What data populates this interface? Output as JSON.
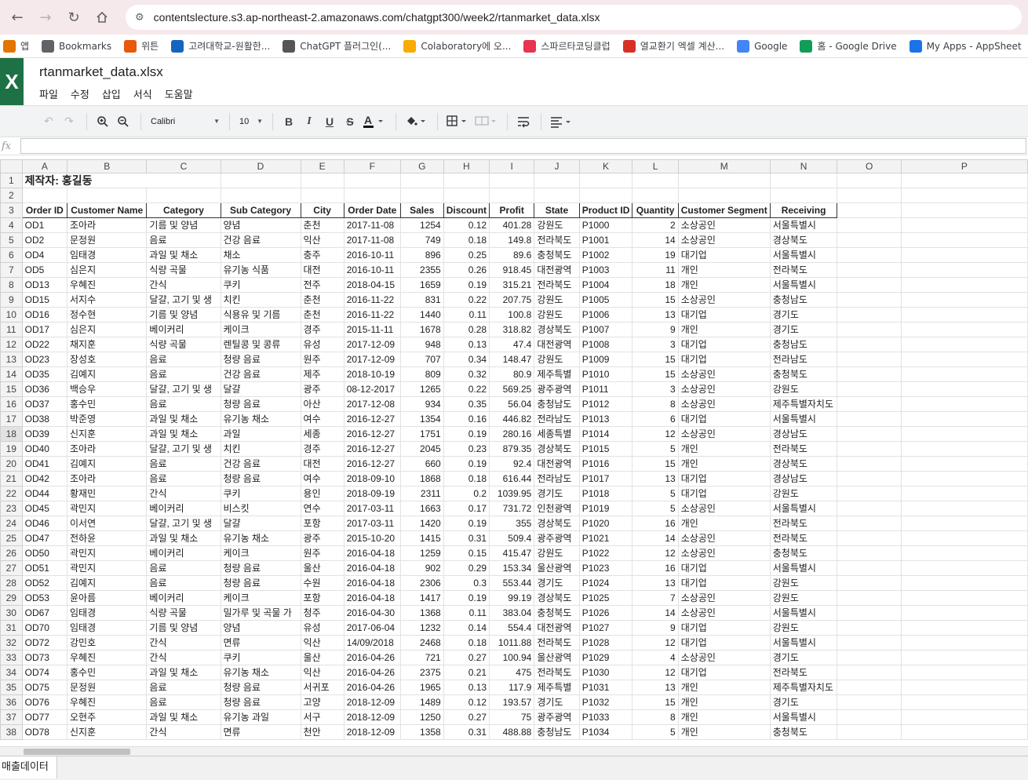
{
  "browser": {
    "url": "contentslecture.s3.ap-northeast-2.amazonaws.com/chatgpt300/week2/rtanmarket_data.xlsx"
  },
  "bookmarks": [
    {
      "label": "앱",
      "icon": "apps-grid-icon",
      "color": "#e37400"
    },
    {
      "label": "Bookmarks",
      "icon": "star-icon",
      "color": "#5f6368"
    },
    {
      "label": "위튼",
      "icon": "wetoon-icon",
      "color": "#e8590c"
    },
    {
      "label": "고려대학교-원활한...",
      "icon": "korea-univ-icon",
      "color": "#1565c0"
    },
    {
      "label": "ChatGPT 플러그인(...",
      "icon": "chatgpt-plugin-icon",
      "color": "#555555"
    },
    {
      "label": "Colaboratory에 오...",
      "icon": "colab-icon",
      "color": "#f9ab00"
    },
    {
      "label": "스파르타코딩클럽",
      "icon": "sparta-icon",
      "color": "#e8344e"
    },
    {
      "label": "열교환기 엑셀 계산...",
      "icon": "heat-exchanger-icon",
      "color": "#d93025"
    },
    {
      "label": "Google",
      "icon": "google-icon",
      "color": "#4285f4"
    },
    {
      "label": "홈 - Google Drive",
      "icon": "google-drive-icon",
      "color": "#0f9d58"
    },
    {
      "label": "My Apps - AppSheet",
      "icon": "appsheet-icon",
      "color": "#1a73e8"
    }
  ],
  "app": {
    "logo": "X",
    "title": "rtanmarket_data.xlsx",
    "menus": [
      "파일",
      "수정",
      "삽입",
      "서식",
      "도움말"
    ],
    "font_name": "Calibri",
    "font_size": "10",
    "formula_label": "fx"
  },
  "sheet": {
    "columns": [
      "A",
      "B",
      "C",
      "D",
      "E",
      "F",
      "G",
      "H",
      "I",
      "J",
      "K",
      "L",
      "M",
      "N",
      "O",
      "P"
    ],
    "title_cell": "제작자: 홍길동",
    "headers": [
      "Order ID",
      "Customer Name",
      "Category",
      "Sub Category",
      "City",
      "Order Date",
      "Sales",
      "Discount",
      "Profit",
      "State",
      "Product ID",
      "Quantity",
      "Customer Segment",
      "Receiving"
    ],
    "rows": [
      [
        "OD1",
        "조아라",
        "기름 및 양념",
        "양념",
        "춘천",
        "2017-11-08",
        "1254",
        "0.12",
        "401.28",
        "강원도",
        "P1000",
        "2",
        "소상공인",
        "서울특별시"
      ],
      [
        "OD2",
        "문정원",
        "음료",
        "건강 음료",
        "익산",
        "2017-11-08",
        "749",
        "0.18",
        "149.8",
        "전라북도",
        "P1001",
        "14",
        "소상공인",
        "경상북도"
      ],
      [
        "OD4",
        "임태경",
        "과일 및 채소",
        "채소",
        "충주",
        "2016-10-11",
        "896",
        "0.25",
        "89.6",
        "충청북도",
        "P1002",
        "19",
        "대기업",
        "서울특별시"
      ],
      [
        "OD5",
        "심은지",
        "식량 곡물",
        "유기농 식품",
        "대전",
        "2016-10-11",
        "2355",
        "0.26",
        "918.45",
        "대전광역",
        "P1003",
        "11",
        "개인",
        "전라북도"
      ],
      [
        "OD13",
        "우혜진",
        "간식",
        "쿠키",
        "전주",
        "2018-04-15",
        "1659",
        "0.19",
        "315.21",
        "전라북도",
        "P1004",
        "18",
        "개인",
        "서울특별시"
      ],
      [
        "OD15",
        "서지수",
        "달걀, 고기 및 생",
        "치킨",
        "춘천",
        "2016-11-22",
        "831",
        "0.22",
        "207.75",
        "강원도",
        "P1005",
        "15",
        "소상공인",
        "충청남도"
      ],
      [
        "OD16",
        "정수현",
        "기름 및 양념",
        "식용유 및 기름",
        "춘천",
        "2016-11-22",
        "1440",
        "0.11",
        "100.8",
        "강원도",
        "P1006",
        "13",
        "대기업",
        "경기도"
      ],
      [
        "OD17",
        "심은지",
        "베이커리",
        "케이크",
        "경주",
        "2015-11-11",
        "1678",
        "0.28",
        "318.82",
        "경상북도",
        "P1007",
        "9",
        "개인",
        "경기도"
      ],
      [
        "OD22",
        "채지훈",
        "식량 곡물",
        "렌틸콩 및 콩류",
        "유성",
        "2017-12-09",
        "948",
        "0.13",
        "47.4",
        "대전광역",
        "P1008",
        "3",
        "대기업",
        "충청남도"
      ],
      [
        "OD23",
        "장성호",
        "음료",
        "청량 음료",
        "원주",
        "2017-12-09",
        "707",
        "0.34",
        "148.47",
        "강원도",
        "P1009",
        "15",
        "대기업",
        "전라남도"
      ],
      [
        "OD35",
        "김예지",
        "음료",
        "건강 음료",
        "제주",
        "2018-10-19",
        "809",
        "0.32",
        "80.9",
        "제주특별",
        "P1010",
        "15",
        "소상공인",
        "충청북도"
      ],
      [
        "OD36",
        "백승우",
        "달걀, 고기 및 생",
        "달걀",
        "광주",
        "08-12-2017",
        "1265",
        "0.22",
        "569.25",
        "광주광역",
        "P1011",
        "3",
        "소상공인",
        "강원도"
      ],
      [
        "OD37",
        "홍수민",
        "음료",
        "청량 음료",
        "아산",
        "2017-12-08",
        "934",
        "0.35",
        "56.04",
        "충청남도",
        "P1012",
        "8",
        "소상공인",
        "제주특별자치도"
      ],
      [
        "OD38",
        "박준영",
        "과일 및 채소",
        "유기농 채소",
        "여수",
        "2016-12-27",
        "1354",
        "0.16",
        "446.82",
        "전라남도",
        "P1013",
        "6",
        "대기업",
        "서울특별시"
      ],
      [
        "OD39",
        "신지훈",
        "과일 및 채소",
        "과일",
        "세종",
        "2016-12-27",
        "1751",
        "0.19",
        "280.16",
        "세종특별",
        "P1014",
        "12",
        "소상공인",
        "경상남도"
      ],
      [
        "OD40",
        "조아라",
        "달걀, 고기 및 생",
        "치킨",
        "경주",
        "2016-12-27",
        "2045",
        "0.23",
        "879.35",
        "경상북도",
        "P1015",
        "5",
        "개인",
        "전라북도"
      ],
      [
        "OD41",
        "김예지",
        "음료",
        "건강 음료",
        "대전",
        "2016-12-27",
        "660",
        "0.19",
        "92.4",
        "대전광역",
        "P1016",
        "15",
        "개인",
        "경상북도"
      ],
      [
        "OD42",
        "조아라",
        "음료",
        "청량 음료",
        "여수",
        "2018-09-10",
        "1868",
        "0.18",
        "616.44",
        "전라남도",
        "P1017",
        "13",
        "대기업",
        "경상남도"
      ],
      [
        "OD44",
        "황재민",
        "간식",
        "쿠키",
        "용인",
        "2018-09-19",
        "2311",
        "0.2",
        "1039.95",
        "경기도",
        "P1018",
        "5",
        "대기업",
        "강원도"
      ],
      [
        "OD45",
        "곽민지",
        "베이커리",
        "비스킷",
        "연수",
        "2017-03-11",
        "1663",
        "0.17",
        "731.72",
        "인천광역",
        "P1019",
        "5",
        "소상공인",
        "서울특별시"
      ],
      [
        "OD46",
        "이서연",
        "달걀, 고기 및 생",
        "달걀",
        "포항",
        "2017-03-11",
        "1420",
        "0.19",
        "355",
        "경상북도",
        "P1020",
        "16",
        "개인",
        "전라북도"
      ],
      [
        "OD47",
        "전하윤",
        "과일 및 채소",
        "유기농 채소",
        "광주",
        "2015-10-20",
        "1415",
        "0.31",
        "509.4",
        "광주광역",
        "P1021",
        "14",
        "소상공인",
        "전라북도"
      ],
      [
        "OD50",
        "곽민지",
        "베이커리",
        "케이크",
        "원주",
        "2016-04-18",
        "1259",
        "0.15",
        "415.47",
        "강원도",
        "P1022",
        "12",
        "소상공인",
        "충청북도"
      ],
      [
        "OD51",
        "곽민지",
        "음료",
        "청량 음료",
        "울산",
        "2016-04-18",
        "902",
        "0.29",
        "153.34",
        "울산광역",
        "P1023",
        "16",
        "대기업",
        "서울특별시"
      ],
      [
        "OD52",
        "김예지",
        "음료",
        "청량 음료",
        "수원",
        "2016-04-18",
        "2306",
        "0.3",
        "553.44",
        "경기도",
        "P1024",
        "13",
        "대기업",
        "강원도"
      ],
      [
        "OD53",
        "윤아름",
        "베이커리",
        "케이크",
        "포항",
        "2016-04-18",
        "1417",
        "0.19",
        "99.19",
        "경상북도",
        "P1025",
        "7",
        "소상공인",
        "강원도"
      ],
      [
        "OD67",
        "임태경",
        "식량 곡물",
        "밀가루 및 곡물 가",
        "청주",
        "2016-04-30",
        "1368",
        "0.11",
        "383.04",
        "충청북도",
        "P1026",
        "14",
        "소상공인",
        "서울특별시"
      ],
      [
        "OD70",
        "임태경",
        "기름 및 양념",
        "양념",
        "유성",
        "2017-06-04",
        "1232",
        "0.14",
        "554.4",
        "대전광역",
        "P1027",
        "9",
        "대기업",
        "강원도"
      ],
      [
        "OD72",
        "강민호",
        "간식",
        "면류",
        "익산",
        "14/09/2018",
        "2468",
        "0.18",
        "1011.88",
        "전라북도",
        "P1028",
        "12",
        "대기업",
        "서울특별시"
      ],
      [
        "OD73",
        "우혜진",
        "간식",
        "쿠키",
        "울산",
        "2016-04-26",
        "721",
        "0.27",
        "100.94",
        "울산광역",
        "P1029",
        "4",
        "소상공인",
        "경기도"
      ],
      [
        "OD74",
        "홍수민",
        "과일 및 채소",
        "유기농 채소",
        "익산",
        "2016-04-26",
        "2375",
        "0.21",
        "475",
        "전라북도",
        "P1030",
        "12",
        "대기업",
        "전라북도"
      ],
      [
        "OD75",
        "문정원",
        "음료",
        "청량 음료",
        "서귀포",
        "2016-04-26",
        "1965",
        "0.13",
        "117.9",
        "제주특별",
        "P1031",
        "13",
        "개인",
        "제주특별자치도"
      ],
      [
        "OD76",
        "우혜진",
        "음료",
        "청량 음료",
        "고양",
        "2018-12-09",
        "1489",
        "0.12",
        "193.57",
        "경기도",
        "P1032",
        "15",
        "개인",
        "경기도"
      ],
      [
        "OD77",
        "오현주",
        "과일 및 채소",
        "유기농 과일",
        "서구",
        "2018-12-09",
        "1250",
        "0.27",
        "75",
        "광주광역",
        "P1033",
        "8",
        "개인",
        "서울특별시"
      ],
      [
        "OD78",
        "신지훈",
        "간식",
        "면류",
        "천안",
        "2018-12-09",
        "1358",
        "0.31",
        "488.88",
        "충청남도",
        "P1034",
        "5",
        "개인",
        "충청북도"
      ]
    ],
    "selected_row": 18,
    "tab_name": "매출데이터"
  }
}
